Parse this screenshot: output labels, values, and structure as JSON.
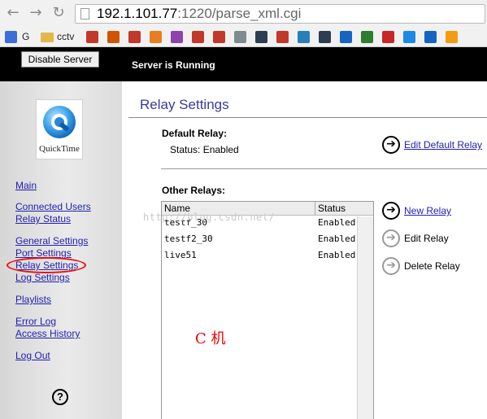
{
  "browser": {
    "url_host": "192.1.101.77",
    "url_rest": ":1220/parse_xml.cgi",
    "bookmarks": [
      {
        "icon": "google-icon",
        "label": "G",
        "color": "#3a6fd8"
      },
      {
        "icon": "folder-icon",
        "label": "cctv",
        "color": "#e2b84a"
      }
    ],
    "bookmark_icons": [
      "#c0392b",
      "#d35400",
      "#c0392b",
      "#e67e22",
      "#8e44ad",
      "#c0392b",
      "#c0392b",
      "#7f8c8d",
      "#2c3e50",
      "#c0392b",
      "#2980b9",
      "#2c3e50",
      "#1565c0",
      "#2e7d32",
      "#c62828",
      "#1e88e5",
      "#1565c0",
      "#f39c12"
    ]
  },
  "server_bar": {
    "disable_button": "Disable Server",
    "status": "Server is Running"
  },
  "sidebar": {
    "logo_text": "QuickTime",
    "links": [
      {
        "label": "Main",
        "top": 0
      },
      {
        "label": "Connected Users"
      },
      {
        "label": "Relay Status"
      },
      {
        "label": "General Settings"
      },
      {
        "label": "Port Settings"
      },
      {
        "label": "Relay Settings"
      },
      {
        "label": "Log Settings"
      },
      {
        "label": "Playlists"
      },
      {
        "label": "Error Log"
      },
      {
        "label": "Access History"
      },
      {
        "label": "Log Out"
      }
    ],
    "help_icon": "?"
  },
  "main": {
    "title": "Relay Settings",
    "default_relay": {
      "heading": "Default Relay:",
      "status": "Status: Enabled",
      "edit_link": "Edit Default Relay"
    },
    "other_relays": {
      "heading": "Other Relays:",
      "columns": [
        "Name",
        "Status"
      ],
      "rows": [
        {
          "name": "testf_30",
          "status": "Enabled"
        },
        {
          "name": "testf2_30",
          "status": "Enabled"
        },
        {
          "name": "live51",
          "status": "Enabled"
        }
      ]
    },
    "actions": {
      "new_relay": "New Relay",
      "edit_relay": "Edit Relay",
      "delete_relay": "Delete Relay"
    },
    "watermark": "http://blog.csdn.net/",
    "annotation": "C 机"
  }
}
